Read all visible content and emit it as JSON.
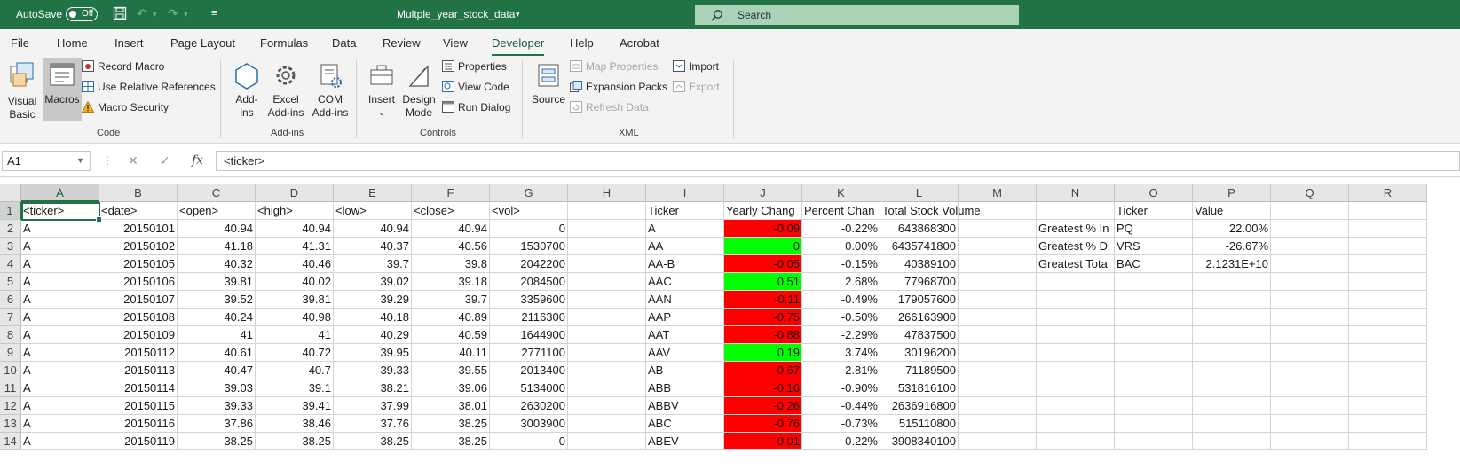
{
  "titlebar": {
    "autosave_label": "AutoSave",
    "autosave_state": "Off",
    "doc_title": "Multple_year_stock_data",
    "search_placeholder": "Search"
  },
  "menu": [
    "File",
    "Home",
    "Insert",
    "Page Layout",
    "Formulas",
    "Data",
    "Review",
    "View",
    "Developer",
    "Help",
    "Acrobat"
  ],
  "menu_active": "Developer",
  "ribbon": {
    "code": {
      "visual_basic": [
        "Visual",
        "Basic"
      ],
      "macros": "Macros",
      "record_macro": "Record Macro",
      "relative_refs": "Use Relative References",
      "macro_security": "Macro Security",
      "label": "Code"
    },
    "addins": {
      "addins": [
        "Add-",
        "ins"
      ],
      "excel_addins": [
        "Excel",
        "Add-ins"
      ],
      "com_addins": [
        "COM",
        "Add-ins"
      ],
      "label": "Add-ins"
    },
    "controls": {
      "insert": "Insert",
      "design_mode": [
        "Design",
        "Mode"
      ],
      "properties": "Properties",
      "view_code": "View Code",
      "run_dialog": "Run Dialog",
      "label": "Controls"
    },
    "xml": {
      "source": "Source",
      "map_properties": "Map Properties",
      "expansion_packs": "Expansion Packs",
      "refresh_data": "Refresh Data",
      "import": "Import",
      "export": "Export",
      "label": "XML"
    }
  },
  "formula_bar": {
    "name_box": "A1",
    "formula": "<ticker>"
  },
  "columns": [
    "A",
    "B",
    "C",
    "D",
    "E",
    "F",
    "G",
    "H",
    "I",
    "J",
    "K",
    "L",
    "M",
    "N",
    "O",
    "P",
    "Q",
    "R"
  ],
  "selected_column": "A",
  "selected_row": 1,
  "header_row": [
    "<ticker>",
    "<date>",
    "<open>",
    "<high>",
    "<low>",
    "<close>",
    "<vol>",
    "",
    "Ticker",
    "Yearly Chang",
    "Percent Chan",
    "Total Stock Volume",
    "",
    "",
    "Ticker",
    "Value",
    "",
    ""
  ],
  "rows": [
    {
      "n": 2,
      "cells": [
        "A",
        "20150101",
        "40.94",
        "40.94",
        "40.94",
        "40.94",
        "0",
        "",
        "A",
        "-0.09",
        "-0.22%",
        "643868300",
        "",
        "Greatest % In",
        "PQ",
        "22.00%",
        "",
        ""
      ]
    },
    {
      "n": 3,
      "cells": [
        "A",
        "20150102",
        "41.18",
        "41.31",
        "40.37",
        "40.56",
        "1530700",
        "",
        "AA",
        "0",
        "0.00%",
        "6435741800",
        "",
        "Greatest % D",
        "VRS",
        "-26.67%",
        "",
        ""
      ]
    },
    {
      "n": 4,
      "cells": [
        "A",
        "20150105",
        "40.32",
        "40.46",
        "39.7",
        "39.8",
        "2042200",
        "",
        "AA-B",
        "-0.05",
        "-0.15%",
        "40389100",
        "",
        "Greatest Tota",
        "BAC",
        "2.1231E+10",
        "",
        ""
      ]
    },
    {
      "n": 5,
      "cells": [
        "A",
        "20150106",
        "39.81",
        "40.02",
        "39.02",
        "39.18",
        "2084500",
        "",
        "AAC",
        "0.51",
        "2.68%",
        "77968700",
        "",
        "",
        "",
        "",
        "",
        ""
      ]
    },
    {
      "n": 6,
      "cells": [
        "A",
        "20150107",
        "39.52",
        "39.81",
        "39.29",
        "39.7",
        "3359600",
        "",
        "AAN",
        "-0.11",
        "-0.49%",
        "179057600",
        "",
        "",
        "",
        "",
        "",
        ""
      ]
    },
    {
      "n": 7,
      "cells": [
        "A",
        "20150108",
        "40.24",
        "40.98",
        "40.18",
        "40.89",
        "2116300",
        "",
        "AAP",
        "-0.75",
        "-0.50%",
        "266163900",
        "",
        "",
        "",
        "",
        "",
        ""
      ]
    },
    {
      "n": 8,
      "cells": [
        "A",
        "20150109",
        "41",
        "41",
        "40.29",
        "40.59",
        "1644900",
        "",
        "AAT",
        "-0.88",
        "-2.29%",
        "47837500",
        "",
        "",
        "",
        "",
        "",
        ""
      ]
    },
    {
      "n": 9,
      "cells": [
        "A",
        "20150112",
        "40.61",
        "40.72",
        "39.95",
        "40.11",
        "2771100",
        "",
        "AAV",
        "0.19",
        "3.74%",
        "30196200",
        "",
        "",
        "",
        "",
        "",
        ""
      ]
    },
    {
      "n": 10,
      "cells": [
        "A",
        "20150113",
        "40.47",
        "40.7",
        "39.33",
        "39.55",
        "2013400",
        "",
        "AB",
        "-0.67",
        "-2.81%",
        "71189500",
        "",
        "",
        "",
        "",
        "",
        ""
      ]
    },
    {
      "n": 11,
      "cells": [
        "A",
        "20150114",
        "39.03",
        "39.1",
        "38.21",
        "39.06",
        "5134000",
        "",
        "ABB",
        "-0.16",
        "-0.90%",
        "531816100",
        "",
        "",
        "",
        "",
        "",
        ""
      ]
    },
    {
      "n": 12,
      "cells": [
        "A",
        "20150115",
        "39.33",
        "39.41",
        "37.99",
        "38.01",
        "2630200",
        "",
        "ABBV",
        "-0.26",
        "-0.44%",
        "2636916800",
        "",
        "",
        "",
        "",
        "",
        ""
      ]
    },
    {
      "n": 13,
      "cells": [
        "A",
        "20150116",
        "37.86",
        "38.46",
        "37.76",
        "38.25",
        "3003900",
        "",
        "ABC",
        "-0.76",
        "-0.73%",
        "515110800",
        "",
        "",
        "",
        "",
        "",
        ""
      ]
    },
    {
      "n": 14,
      "cells": [
        "A",
        "20150119",
        "38.25",
        "38.25",
        "38.25",
        "38.25",
        "0",
        "",
        "ABEV",
        "-0.01",
        "-0.22%",
        "3908340100",
        "",
        "",
        "",
        "",
        "",
        ""
      ]
    }
  ],
  "colors": {
    "excel_green": "#217346",
    "negative_fill": "#ff0000",
    "positive_fill": "#00ff00"
  }
}
